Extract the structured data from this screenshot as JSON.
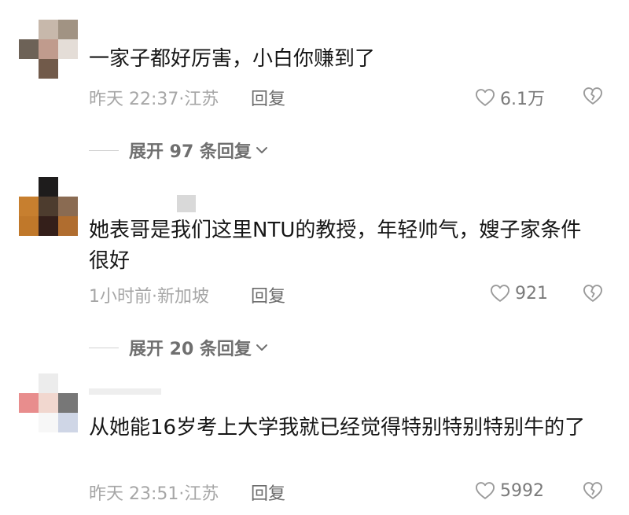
{
  "comments": [
    {
      "text": "一家子都好厉害，小白你赚到了",
      "time": "昨天 22:37",
      "location": "江苏",
      "reply_label": "回复",
      "likes": "6.1万",
      "expand_label": "展开 97 条回复",
      "avatar_colors": [
        "#ffffff",
        "#c7b8ab",
        "#a19383",
        "#6d6257",
        "#c09b8d",
        "#e4ddd7",
        "#ffffff",
        "#715a4a",
        "#ffffff"
      ]
    },
    {
      "text": "她表哥是我们这里NTU的教授，年轻帅气，嫂子家条件很好",
      "time": "1小时前",
      "location": "新加坡",
      "reply_label": "回复",
      "likes": "921",
      "expand_label": "展开 20 条回复",
      "avatar_colors": [
        "#ffffff",
        "#1e1c1c",
        "#ffffff",
        "#c77f2f",
        "#4d3c2e",
        "#8a6b52",
        "#c0782a",
        "#341f1a",
        "#b06d2f"
      ]
    },
    {
      "text": "从她能16岁考上大学我就已经觉得特别特别特别牛的了",
      "time": "昨天 23:51",
      "location": "江苏",
      "reply_label": "回复",
      "likes": "5992",
      "avatar_colors": [
        "#ffffff",
        "#ececec",
        "#ffffff",
        "#e88d8d",
        "#f1d7cf",
        "#777777",
        "#ffffff",
        "#f7f7f7",
        "#cfd6e6"
      ]
    }
  ],
  "icons": {
    "like": "heart-outline-icon",
    "dislike": "broken-heart-icon",
    "expand": "chevron-down-icon"
  },
  "colors": {
    "text": "#161616",
    "meta": "#a6a6a6",
    "icon": "#9a9a9a"
  }
}
